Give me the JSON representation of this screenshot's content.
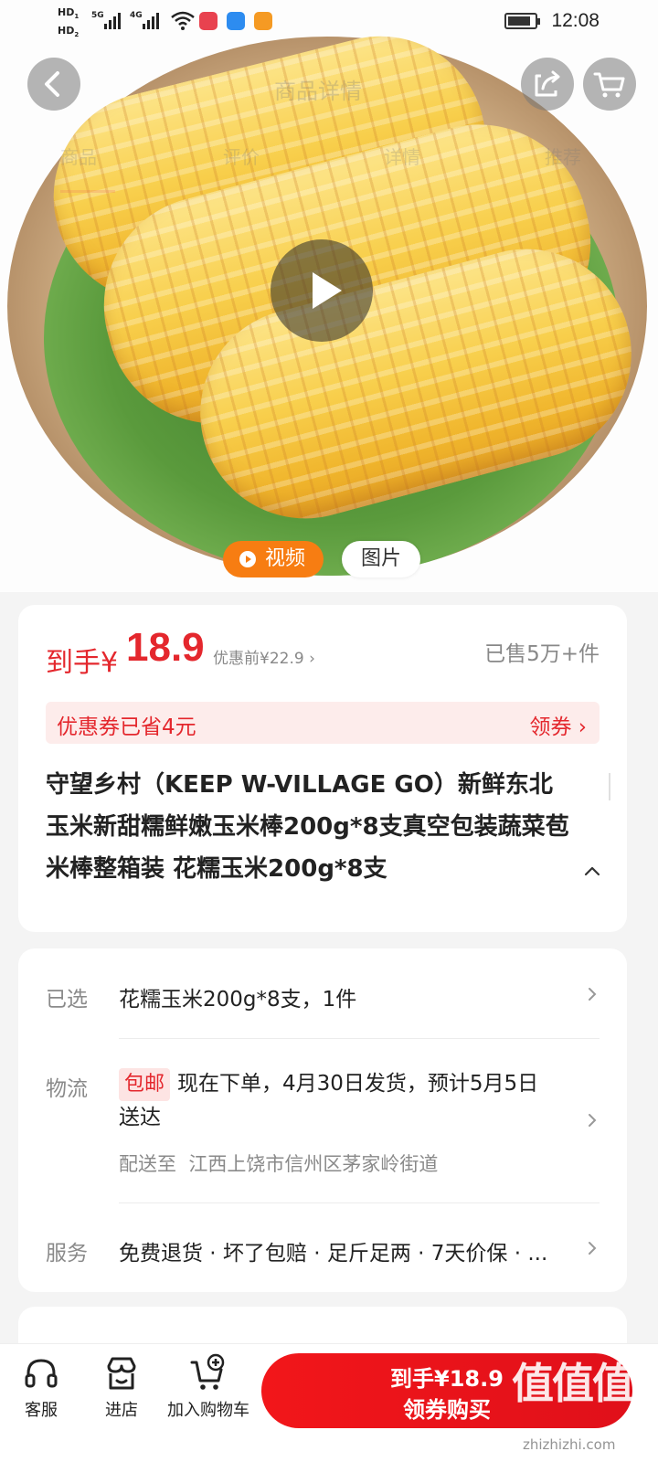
{
  "status_bar": {
    "time": "12:08",
    "hd1": "HD",
    "hd2": "HD",
    "net1": "5G",
    "net2": "4G"
  },
  "hero": {
    "faint_title": "商品详情",
    "faint_tabs": [
      "商品",
      "评价",
      "详情",
      "推荐"
    ],
    "media_toggle": {
      "video": "视频",
      "photo": "图片"
    }
  },
  "price_card": {
    "price_prefix": "到手¥",
    "price": "18.9",
    "price_before": "优惠前¥22.9 ›",
    "sold": "已售5万+件",
    "coupon_text": "优惠券已省4元",
    "coupon_link": "领券 ›",
    "title": "守望乡村（KEEP W-VILLAGE GO）新鲜东北玉米新甜糯鲜嫩玉米棒200g*8支真空包装蔬菜苞米棒整箱装 花糯玉米200g*8支"
  },
  "info_card": {
    "selected_label": "已选",
    "selected_value": "花糯玉米200g*8支，1件",
    "logistics_label": "物流",
    "free_ship": "包邮",
    "logistics_value": "现在下单，4月30日发货，预计5月5日送达",
    "deliver_to_label": "配送至",
    "deliver_to": "江西上饶市信州区茅家岭街道",
    "service_label": "服务",
    "service_value": "免费退货 · 坏了包赔 · 足斤足两 · 7天价保 · ..."
  },
  "bottom_bar": {
    "service": "客服",
    "store": "进店",
    "add_cart": "加入购物车",
    "buy_price": "到手¥18.9",
    "buy_label": "领券购买"
  },
  "watermark": {
    "mark": "值值值",
    "url": "zhizhizhi.com"
  }
}
